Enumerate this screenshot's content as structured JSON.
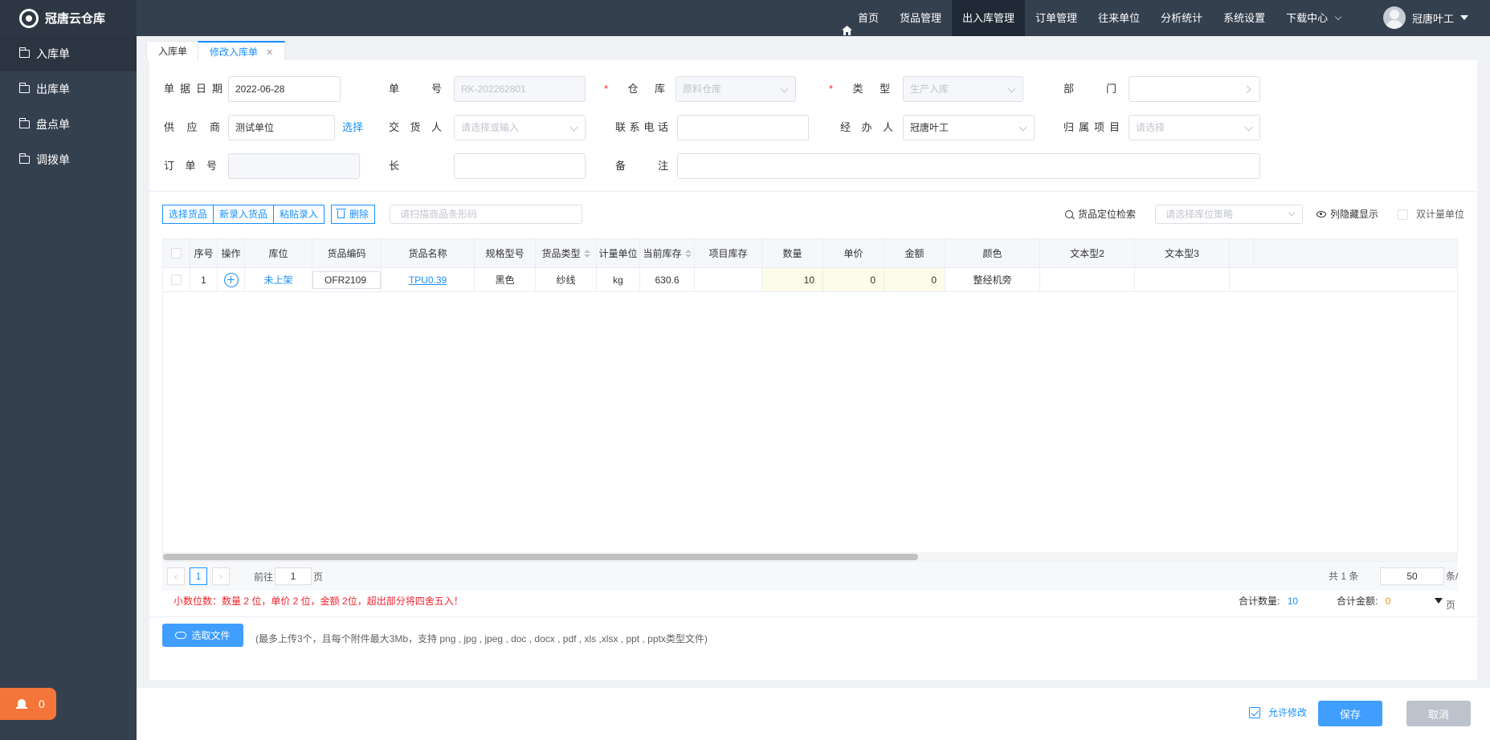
{
  "app": {
    "title": "冠唐云仓库"
  },
  "nav": {
    "items": [
      "首页",
      "货品管理",
      "出入库管理",
      "订单管理",
      "往来单位",
      "分析统计",
      "系统设置",
      "下载中心"
    ],
    "active_index": 2
  },
  "user": {
    "name": "冠唐叶工"
  },
  "sidebar": {
    "items": [
      "入库单",
      "出库单",
      "盘点单",
      "调拨单"
    ],
    "active_index": 0
  },
  "notification": {
    "count": "0"
  },
  "tabs": [
    {
      "label": "入库单"
    },
    {
      "label": "修改入库单",
      "closable": true
    }
  ],
  "form": {
    "date_label": "单据日期",
    "date_value": "2022-06-28",
    "no_label": "单号",
    "no_value": "RK-202262801",
    "warehouse_label": "仓库",
    "warehouse_value": "原料仓库",
    "type_label": "类型",
    "type_value": "生产入库",
    "dept_label": "部门",
    "dept_value": "",
    "supplier_label": "供应商",
    "supplier_value": "测试单位",
    "select_link": "选择",
    "deliverer_label": "交货人",
    "deliverer_placeholder": "请选择或输入",
    "phone_label": "联系电话",
    "phone_value": "",
    "handler_label": "经办人",
    "handler_value": "冠唐叶工",
    "project_label": "归属项目",
    "project_placeholder": "请选择",
    "order_label": "订单号",
    "order_value": "",
    "length_label": "长",
    "length_value": "",
    "remark_label": "备注",
    "remark_value": ""
  },
  "toolbar": {
    "select_goods": "选择货品",
    "new_goods": "新录入货品",
    "paste": "粘贴录入",
    "delete": "删除",
    "scan_placeholder": "请扫描商品条形码",
    "locate": "货品定位检索",
    "strategy_placeholder": "请选择库位策略",
    "column_toggle": "列隐藏显示",
    "dual_unit": "双计量单位"
  },
  "table": {
    "headers": [
      "序号",
      "操作",
      "库位",
      "货品编码",
      "货品名称",
      "规格型号",
      "货品类型",
      "计量单位",
      "当前库存",
      "项目库存",
      "数量",
      "单价",
      "金额",
      "颜色",
      "文本型2",
      "文本型3"
    ],
    "rows": [
      {
        "no": "1",
        "location": "未上架",
        "code": "OFR2109",
        "name": "TPU0.39",
        "spec": "黑色",
        "type": "纱线",
        "unit": "kg",
        "stock": "630.6",
        "project_stock": "",
        "qty": "10",
        "price": "0",
        "amount": "0",
        "color": "整经机旁",
        "text2": "",
        "text3": ""
      }
    ]
  },
  "pager": {
    "current": "1",
    "goto_label": "前往",
    "goto_value": "1",
    "page_unit": "页",
    "total": "共 1 条",
    "size": "50",
    "size_unit": "条/页"
  },
  "summary": {
    "note": "小数位数：数量 2 位，单价 2 位，金额 2位，超出部分将四舍五入！",
    "qty_label": "合计数量:",
    "qty_value": "10",
    "amount_label": "合计金额:",
    "amount_value": "0",
    "qty_color": "#1890ff",
    "amount_color": "#fa8c16"
  },
  "upload": {
    "button": "选取文件",
    "hint": "(最多上传3个，且每个附件最大3Mb，支持 png , jpg , jpeg , doc , docx , pdf , xls ,xlsx , ppt , pptx类型文件)"
  },
  "footer": {
    "allow_edit": "允许修改",
    "save": "保存",
    "cancel": "取消"
  }
}
